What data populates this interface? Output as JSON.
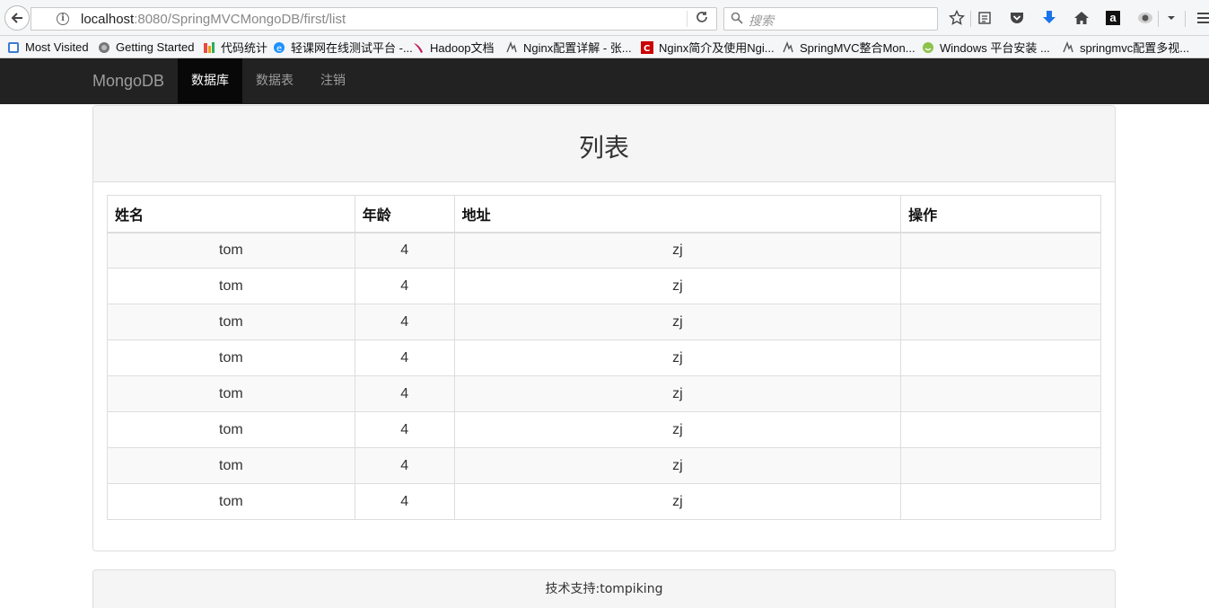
{
  "browser": {
    "url_host": "localhost",
    "url_rest": ":8080/SpringMVCMongoDB/first/list",
    "search_placeholder": "搜索"
  },
  "bookmarks": [
    {
      "label": "Most Visited",
      "icon": "most-visited-icon",
      "color": "#3a7bd5"
    },
    {
      "label": "Getting Started",
      "icon": "firefox-icon",
      "color": "#666666"
    },
    {
      "label": "代码统计",
      "icon": "stats-icon",
      "color": "#e84c3d"
    },
    {
      "label": "轻课网在线测试平台 -...",
      "icon": "ie-icon",
      "color": "#1e90ff"
    },
    {
      "label": "Hadoop文档",
      "icon": "feather-icon",
      "color": "#c2185b"
    },
    {
      "label": "Nginx配置详解 - 张...",
      "icon": "bookmark-icon",
      "color": "#555555"
    },
    {
      "label": "Nginx简介及使用Ngi...",
      "icon": "csdn-icon",
      "color": "#cc0000"
    },
    {
      "label": "SpringMVC整合Mon...",
      "icon": "bookmark-icon",
      "color": "#555555"
    },
    {
      "label": "Windows 平台安装 ...",
      "icon": "smile-icon",
      "color": "#8bc34a"
    },
    {
      "label": "springmvc配置多视...",
      "icon": "bookmark-icon",
      "color": "#555555"
    }
  ],
  "navbar": {
    "brand": "MongoDB",
    "items": [
      {
        "label": "数据库",
        "active": true
      },
      {
        "label": "数据表",
        "active": false
      },
      {
        "label": "注销",
        "active": false
      }
    ]
  },
  "panel": {
    "title": "列表",
    "columns": [
      "姓名",
      "年龄",
      "地址",
      "操作"
    ],
    "rows": [
      [
        "tom",
        "4",
        "zj",
        ""
      ],
      [
        "tom",
        "4",
        "zj",
        ""
      ],
      [
        "tom",
        "4",
        "zj",
        ""
      ],
      [
        "tom",
        "4",
        "zj",
        ""
      ],
      [
        "tom",
        "4",
        "zj",
        ""
      ],
      [
        "tom",
        "4",
        "zj",
        ""
      ],
      [
        "tom",
        "4",
        "zj",
        ""
      ],
      [
        "tom",
        "4",
        "zj",
        ""
      ]
    ]
  },
  "footer": {
    "text": "技术支持:tompiking"
  }
}
